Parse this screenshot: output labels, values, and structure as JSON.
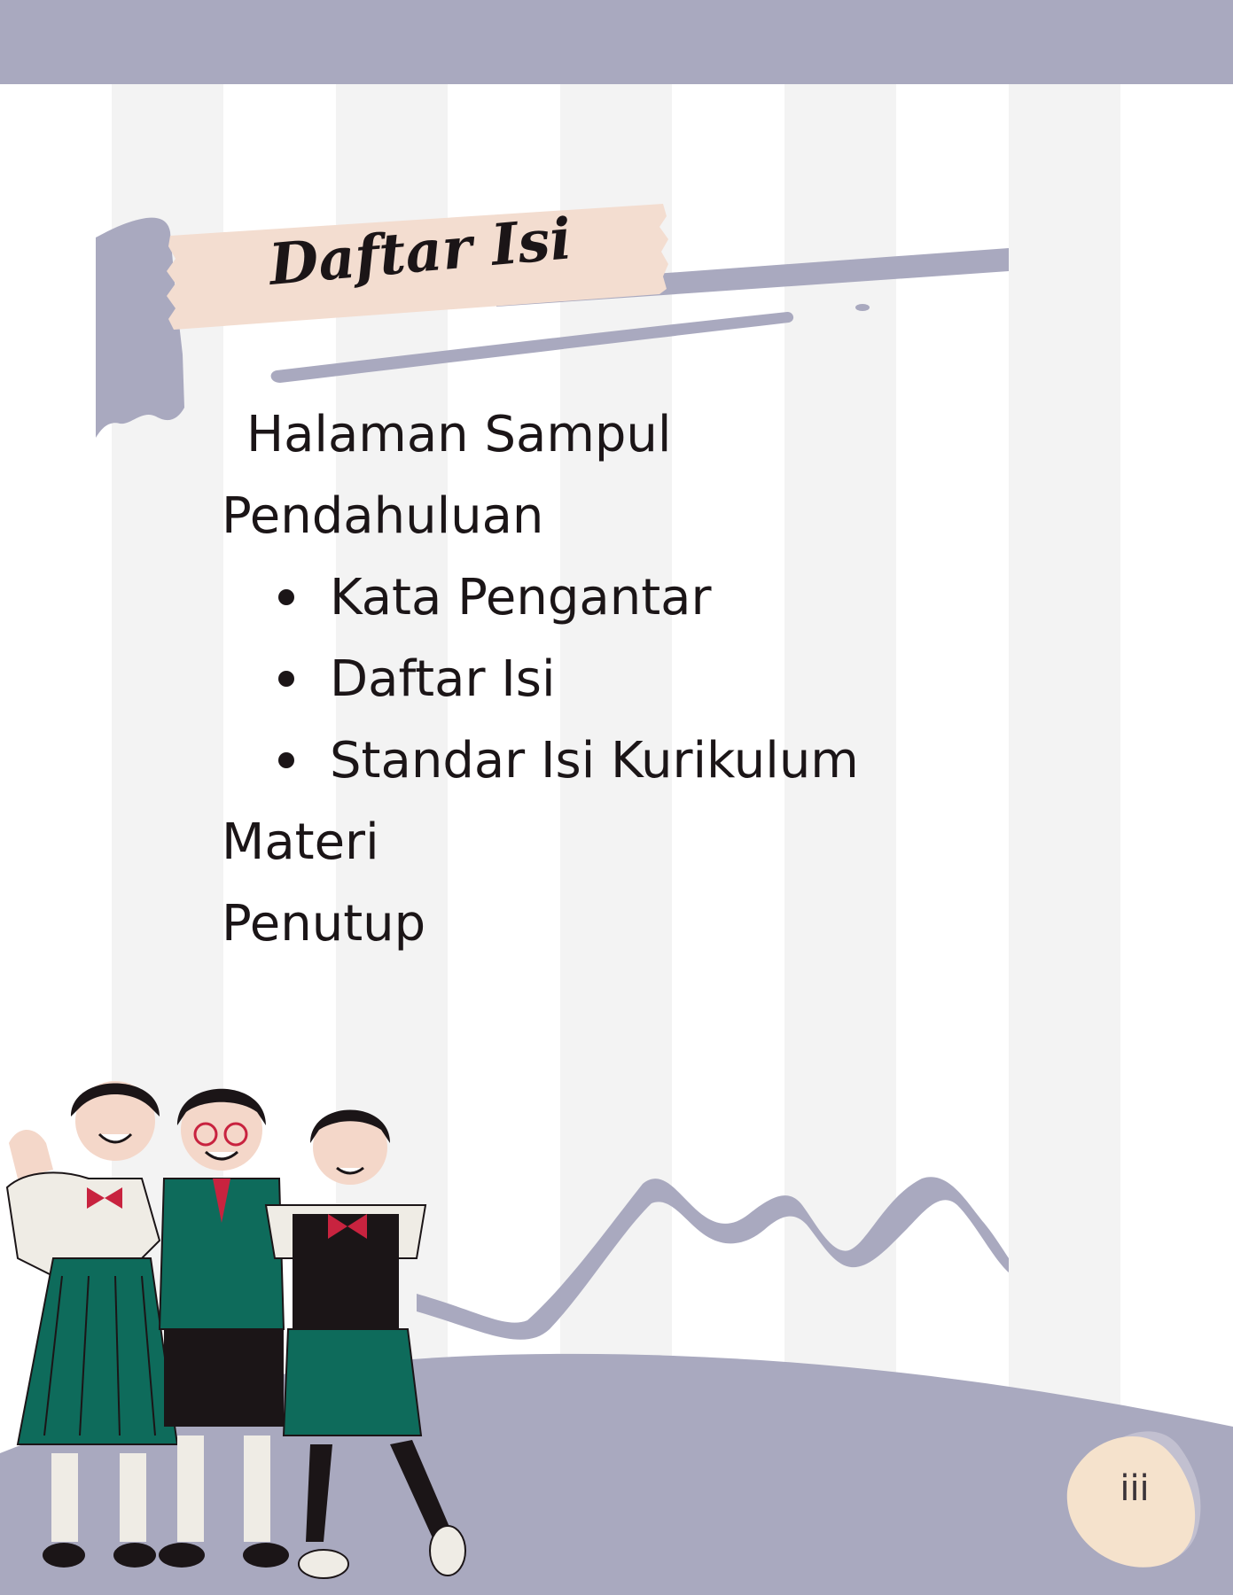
{
  "heading": {
    "title": "Daftar Isi"
  },
  "toc": {
    "items": [
      {
        "label": "Halaman Sampul"
      },
      {
        "label": "Pendahuluan"
      },
      {
        "label": "Kata Pengantar"
      },
      {
        "label": "Daftar Isi"
      },
      {
        "label": "Standar Isi Kurikulum"
      },
      {
        "label": "Materi"
      },
      {
        "label": "Penutup"
      }
    ]
  },
  "footer": {
    "page_number": "iii"
  },
  "colors": {
    "accent_lavender": "#a9a9bf",
    "tape_peach": "#f3ddd0",
    "page_badge": "#f5e2cc",
    "uniform_green": "#0e6b5b",
    "ribbon_red": "#c8233f",
    "text": "#1b1517"
  },
  "illustration": {
    "subject": "three-schoolgirls-icon"
  }
}
